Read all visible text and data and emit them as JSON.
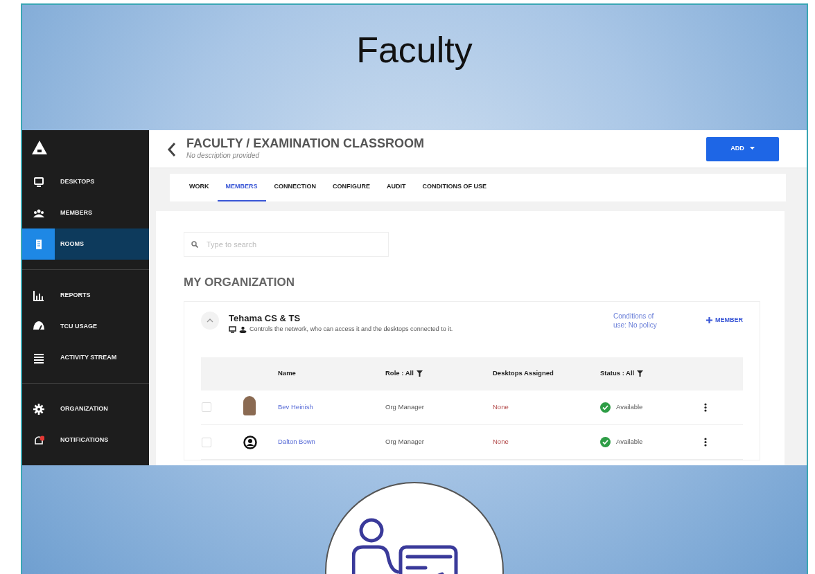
{
  "slide": {
    "title": "Faculty"
  },
  "sidebar": {
    "groups": [
      [
        {
          "label": "DESKTOPS",
          "selected": false
        },
        {
          "label": "MEMBERS",
          "selected": false
        },
        {
          "label": "ROOMS",
          "selected": true
        }
      ],
      [
        {
          "label": "REPORTS",
          "selected": false
        },
        {
          "label": "TCU USAGE",
          "selected": false
        },
        {
          "label": "ACTIVITY STREAM",
          "selected": false
        }
      ],
      [
        {
          "label": "ORGANIZATION",
          "selected": false
        },
        {
          "label": "NOTIFICATIONS",
          "selected": false
        }
      ]
    ]
  },
  "header": {
    "title": "FACULTY / EXAMINATION CLASSROOM",
    "subtitle": "No description provided",
    "add_button": "ADD"
  },
  "tabs": [
    {
      "label": "WORK",
      "selected": false
    },
    {
      "label": "MEMBERS",
      "selected": true
    },
    {
      "label": "CONNECTION",
      "selected": false
    },
    {
      "label": "CONFIGURE",
      "selected": false
    },
    {
      "label": "AUDIT",
      "selected": false
    },
    {
      "label": "CONDITIONS OF USE",
      "selected": false
    }
  ],
  "search": {
    "placeholder": "Type to search"
  },
  "section_title": "MY ORGANIZATION",
  "org": {
    "name": "Tehama CS & TS",
    "expanded": true,
    "description": "Controls the network, who can access it and the desktops connected to it.",
    "conditions_link": "Conditions of use: No policy",
    "add_member": "MEMBER"
  },
  "table": {
    "columns": [
      {
        "label": "Name"
      },
      {
        "label": "Role : All",
        "filter": true
      },
      {
        "label": "Desktops Assigned"
      },
      {
        "label": "Status : All",
        "filter": true
      }
    ],
    "rows": [
      {
        "checked": false,
        "kind": "photo",
        "name": "Bev Heinish",
        "role": "Org Manager",
        "desktops": "None",
        "status": "Available"
      },
      {
        "checked": false,
        "kind": "silhouette",
        "name": "Dalton Bown",
        "role": "Org Manager",
        "desktops": "None",
        "status": "Available"
      }
    ]
  }
}
